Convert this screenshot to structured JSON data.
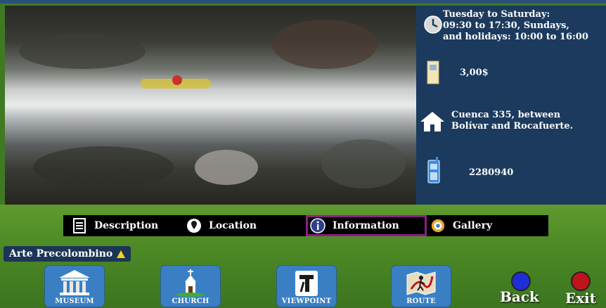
{
  "info_panel": {
    "schedule": [
      "Tuesday to Saturday:",
      "09:30 to 17:30, Sundays,",
      "and holidays: 10:00 to 16:00"
    ],
    "price": "3,00$",
    "address": [
      "Cuenca 335, between",
      "Bolívar and Rocafuerte."
    ],
    "phone": "2280940",
    "icons": {
      "schedule": "clock-icon",
      "price": "ticket-icon",
      "address": "house-icon",
      "phone": "phone-icon"
    }
  },
  "menu": {
    "items": [
      {
        "label": "Description",
        "icon": "document-icon"
      },
      {
        "label": "Location",
        "icon": "location-pin-icon"
      },
      {
        "label": "Information",
        "icon": "info-icon",
        "active": true
      },
      {
        "label": "Gallery",
        "icon": "camera-icon"
      }
    ]
  },
  "place_label": "Arte Precolombino",
  "nav": {
    "buttons": [
      {
        "label": "MUSEUM",
        "icon": "museum-icon"
      },
      {
        "label": "CHURCH",
        "icon": "church-icon"
      },
      {
        "label": "VIEWPOINT",
        "icon": "viewpoint-icon"
      },
      {
        "label": "ROUTE",
        "icon": "route-map-icon"
      }
    ],
    "back_label": "Back",
    "exit_label": "Exit"
  },
  "colors": {
    "info_bg": "#1b3a5e",
    "active_outline": "#8a1f86",
    "nav_button": "#3a7fc4",
    "back_circle": "#1f2fd6",
    "exit_circle": "#c0141c",
    "label_triangle": "#f1d51c"
  }
}
